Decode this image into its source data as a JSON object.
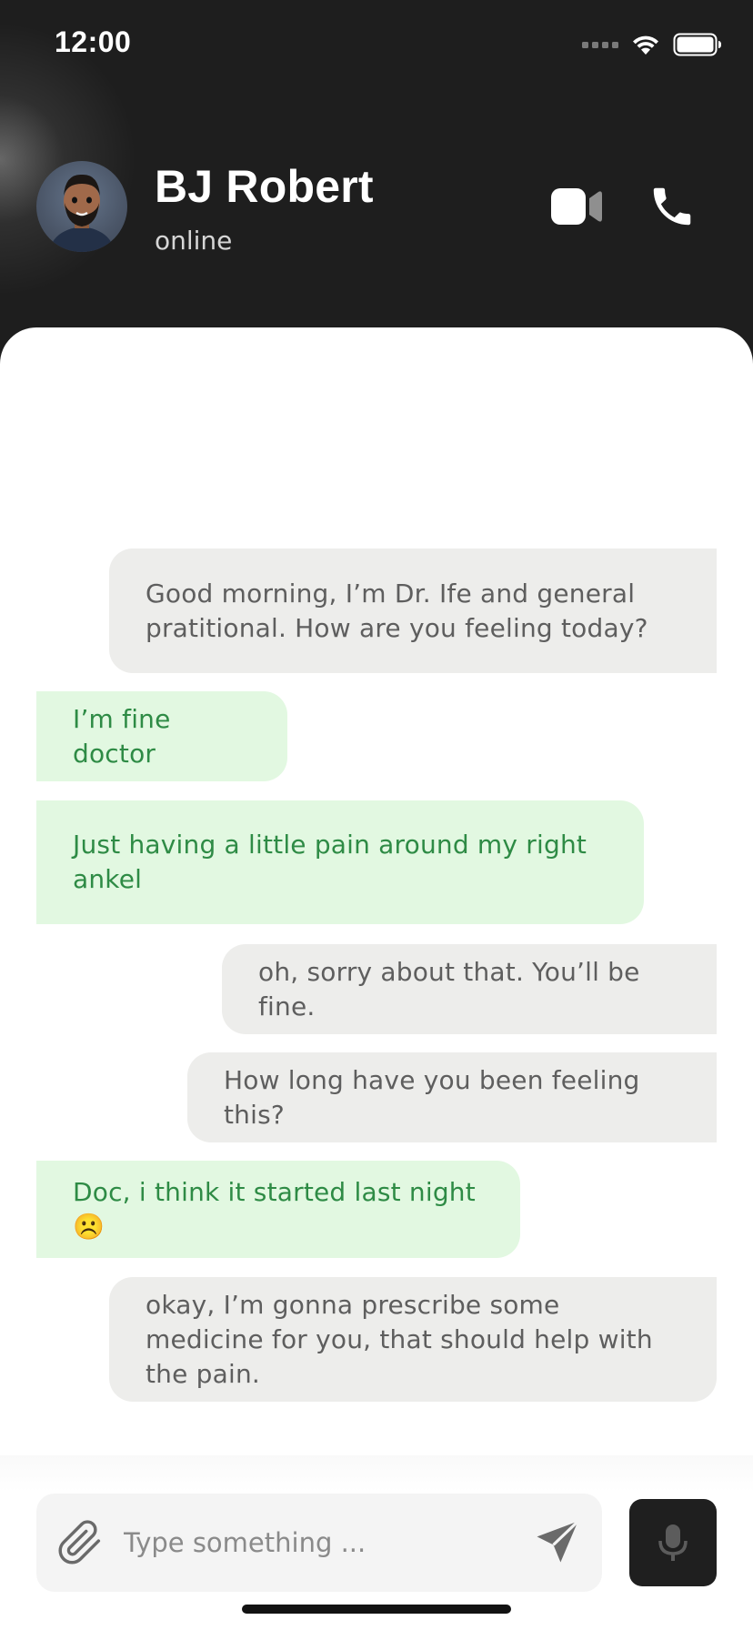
{
  "status_bar": {
    "time": "12:00"
  },
  "contact": {
    "name": "BJ Robert",
    "status": "online"
  },
  "actions": {
    "video_icon": "video-camera-icon",
    "call_icon": "phone-icon"
  },
  "messages": [
    {
      "sender": "doctor",
      "text": "Good morning, I’m Dr. Ife and general pratitional. How are you feeling today?"
    },
    {
      "sender": "patient",
      "text": "I’m fine doctor"
    },
    {
      "sender": "patient",
      "text": "Just having a little pain around my right ankel"
    },
    {
      "sender": "doctor",
      "text": "oh, sorry about that. You’ll be fine."
    },
    {
      "sender": "doctor",
      "text": "How long have you been feeling this?"
    },
    {
      "sender": "patient",
      "text": "Doc, i think it started last night ☹️"
    },
    {
      "sender": "doctor",
      "text": "okay, I’m gonna prescribe some medicine for you, that should help with the pain."
    }
  ],
  "composer": {
    "placeholder": "Type something ..."
  },
  "colors": {
    "header_bg": "#1e1e1e",
    "incoming_bg": "#ededeb",
    "incoming_text": "#5e5e5e",
    "outgoing_bg": "#e2f8e1",
    "outgoing_text": "#2e8b45"
  }
}
